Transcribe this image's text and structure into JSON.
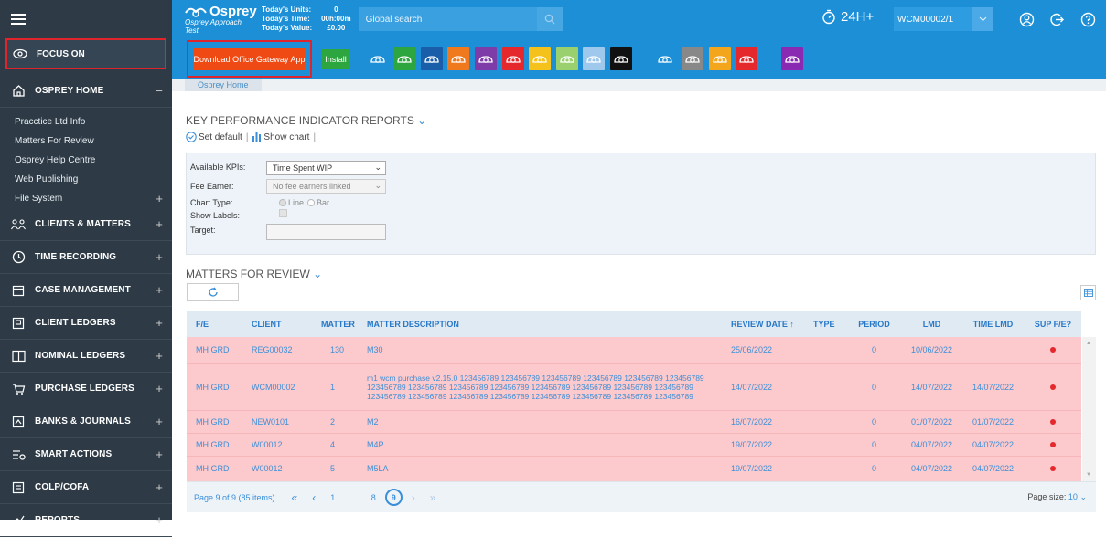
{
  "sidebar": {
    "focus_on": "FOCUS ON",
    "sections": [
      {
        "label": "OSPREY HOME",
        "toggle": "−"
      },
      {
        "label": "CLIENTS & MATTERS",
        "toggle": "+"
      },
      {
        "label": "TIME RECORDING",
        "toggle": "+"
      },
      {
        "label": "CASE MANAGEMENT",
        "toggle": "+"
      },
      {
        "label": "CLIENT LEDGERS",
        "toggle": "+"
      },
      {
        "label": "NOMINAL LEDGERS",
        "toggle": "+"
      },
      {
        "label": "PURCHASE LEDGERS",
        "toggle": "+"
      },
      {
        "label": "BANKS & JOURNALS",
        "toggle": "+"
      },
      {
        "label": "SMART ACTIONS",
        "toggle": "+"
      },
      {
        "label": "COLP/COFA",
        "toggle": "+"
      },
      {
        "label": "REPORTS",
        "toggle": "+"
      }
    ],
    "home_items": [
      {
        "label": "Pracctice Ltd Info",
        "toggle": ""
      },
      {
        "label": "Matters For Review",
        "toggle": ""
      },
      {
        "label": "Osprey Help Centre",
        "toggle": ""
      },
      {
        "label": "Web Publishing",
        "toggle": ""
      },
      {
        "label": "File System",
        "toggle": "+"
      }
    ]
  },
  "header": {
    "brand": "Osprey",
    "brand_sub": "Osprey Approach Test",
    "today_units_label": "Today's Units:",
    "today_time_label": "Today's Time:",
    "today_value_label": "Today's Value:",
    "today_units": "0",
    "today_time": "00h:00m",
    "today_value": "£0.00",
    "search_placeholder": "Global search",
    "timer_label": "24H+",
    "matter_ref": "WCM00002/1"
  },
  "toolbar": {
    "download_label": "Download Office Gateway App",
    "install_label": "Install",
    "tile_colors": [
      "#1c8fd6",
      "#2ea640",
      "#1a5da8",
      "#f0791e",
      "#7e3ca8",
      "#e4282c",
      "#f4c21a",
      "#9bd06e",
      "#9fc9ec",
      "#111111",
      "#1c8fd6",
      "#888888",
      "#f3a51c",
      "#e4282c",
      "#8a2ab2"
    ]
  },
  "breadcrumb": "Osprey Home",
  "kpi": {
    "title": "KEY PERFORMANCE INDICATOR REPORTS",
    "set_default": "Set default",
    "sep1": "|",
    "show_chart": "Show chart",
    "sep2": "|",
    "available_label": "Available KPIs:",
    "available_value": "Time Spent WIP",
    "fee_earner_label": "Fee Earner:",
    "fee_earner_value": "No fee earners linked",
    "chart_type_label": "Chart Type:",
    "chart_line": "Line",
    "chart_bar": "Bar",
    "show_labels_label": "Show Labels:",
    "target_label": "Target:"
  },
  "mfr": {
    "title": "MATTERS FOR REVIEW",
    "columns": [
      "F/E",
      "CLIENT",
      "MATTER",
      "MATTER DESCRIPTION",
      "REVIEW DATE ↑",
      "TYPE",
      "PERIOD",
      "LMD",
      "TIME LMD",
      "SUP F/E?"
    ],
    "rows": [
      {
        "fe": "MH GRD",
        "client": "REG00032",
        "matter": "130",
        "desc": "M30",
        "review": "25/06/2022",
        "type": "",
        "period": "0",
        "lmd": "10/06/2022",
        "time_lmd": ""
      },
      {
        "fe": "MH GRD",
        "client": "WCM00002",
        "matter": "1",
        "desc": "m1 wcm purchase v2.15.0 123456789 123456789 123456789 123456789 123456789 123456789 123456789 123456789 123456789 123456789 123456789 123456789 123456789 123456789 123456789 123456789 123456789 123456789 123456789 123456789 123456789 123456789",
        "review": "14/07/2022",
        "type": "",
        "period": "0",
        "lmd": "14/07/2022",
        "time_lmd": "14/07/2022"
      },
      {
        "fe": "MH GRD",
        "client": "NEW0101",
        "matter": "2",
        "desc": "M2",
        "review": "16/07/2022",
        "type": "",
        "period": "0",
        "lmd": "01/07/2022",
        "time_lmd": "01/07/2022"
      },
      {
        "fe": "MH GRD",
        "client": "W00012",
        "matter": "4",
        "desc": "M4P",
        "review": "19/07/2022",
        "type": "",
        "period": "0",
        "lmd": "04/07/2022",
        "time_lmd": "04/07/2022"
      },
      {
        "fe": "MH GRD",
        "client": "W00012",
        "matter": "5",
        "desc": "M5LA",
        "review": "19/07/2022",
        "type": "",
        "period": "0",
        "lmd": "04/07/2022",
        "time_lmd": "04/07/2022"
      }
    ],
    "pager_info": "Page 9 of 9 (85 items)",
    "pg_first": "«",
    "pg_prev": "‹",
    "pg_1": "1",
    "pg_dots": "...",
    "pg_8": "8",
    "pg_9": "9",
    "pg_next": "›",
    "pg_last": "»",
    "page_size_label": "Page size:",
    "page_size_value": "10"
  }
}
